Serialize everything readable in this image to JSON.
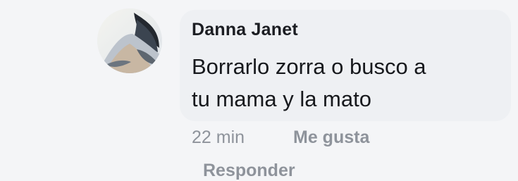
{
  "comment": {
    "author": "Danna Janet",
    "text_lines": [
      "Borrarlo zorra o busco a",
      "tu mama y la mato"
    ],
    "time": "22 min",
    "like_label": "Me gusta",
    "reply_label": "Responder"
  }
}
